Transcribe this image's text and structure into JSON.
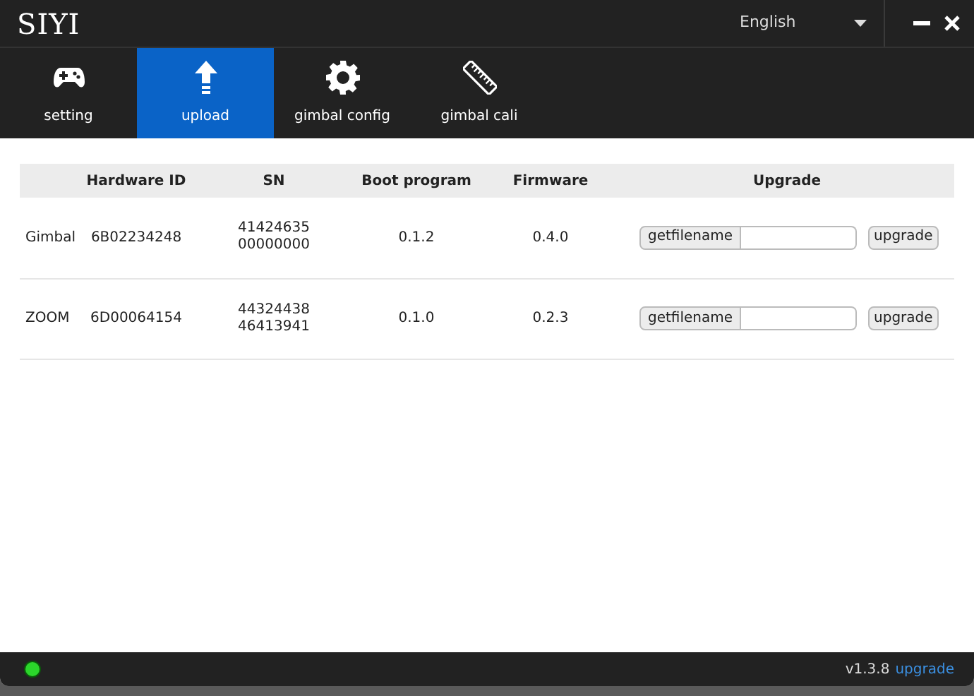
{
  "window": {
    "logo": "SIYI",
    "language": "English"
  },
  "tabs": [
    {
      "label": "setting",
      "kind": "gamepad",
      "selected": false
    },
    {
      "label": "upload",
      "kind": "upload",
      "selected": true
    },
    {
      "label": "gimbal config",
      "kind": "gear",
      "selected": false
    },
    {
      "label": "gimbal cali",
      "kind": "ruler",
      "selected": false
    }
  ],
  "table": {
    "columns": [
      "",
      "Hardware ID",
      "SN",
      "Boot program",
      "Firmware",
      "Upgrade"
    ],
    "rows": [
      {
        "device": "Gimbal",
        "hardware_id": "6B02234248",
        "sn": [
          "41424635",
          "00000000"
        ],
        "boot_program": "0.1.2",
        "firmware": "0.4.0",
        "browse_button": "getfilename",
        "upgrade_button": "upgrade"
      },
      {
        "device": "ZOOM",
        "hardware_id": "6D00064154",
        "sn": [
          "44324438",
          "46413941"
        ],
        "boot_program": "0.1.0",
        "firmware": "0.2.3",
        "browse_button": "getfilename",
        "upgrade_button": "upgrade"
      }
    ]
  },
  "status_bar": {
    "connected": true,
    "version": "v1.3.8",
    "upgrade_link": "upgrade"
  }
}
